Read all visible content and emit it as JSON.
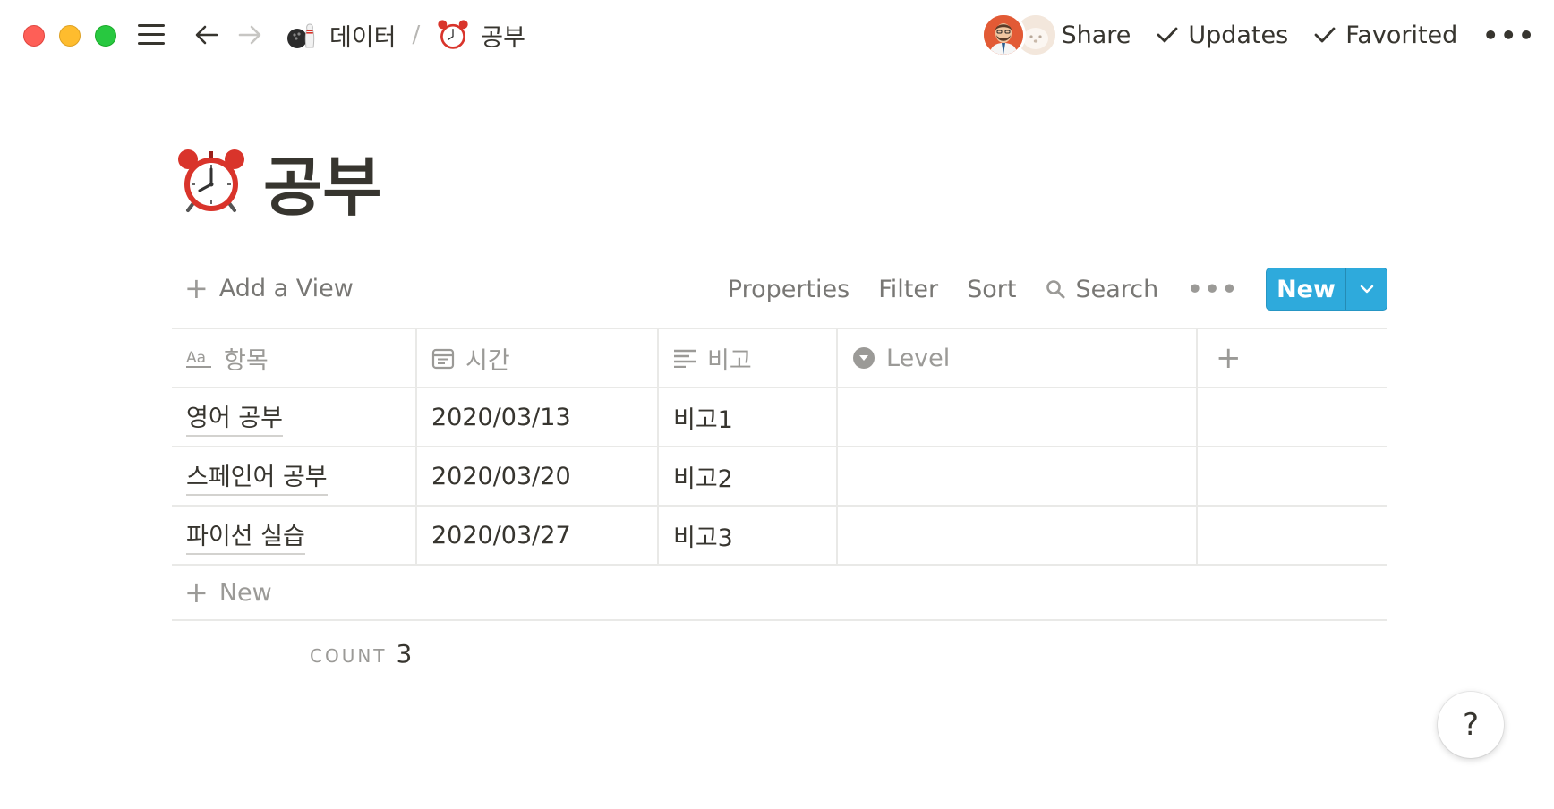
{
  "window": {
    "controls": [
      "close",
      "minimize",
      "zoom"
    ]
  },
  "breadcrumb": {
    "items": [
      {
        "emoji": "🎳",
        "label": "데이터"
      },
      {
        "emoji": "⏰",
        "label": "공부"
      }
    ],
    "separator": "/"
  },
  "topbar": {
    "share_label": "Share",
    "updates_label": "Updates",
    "favorited_label": "Favorited",
    "more_label": "•••"
  },
  "page": {
    "title": "공부",
    "icon": "alarm-clock-icon"
  },
  "view_toolbar": {
    "add_view_label": "Add a View",
    "properties_label": "Properties",
    "filter_label": "Filter",
    "sort_label": "Sort",
    "search_label": "Search",
    "more_label": "•••",
    "new_label": "New"
  },
  "table": {
    "columns": [
      {
        "label": "항목",
        "icon": "text-title-icon"
      },
      {
        "label": "시간",
        "icon": "calendar-icon"
      },
      {
        "label": "비고",
        "icon": "text-lines-icon"
      },
      {
        "label": "Level",
        "icon": "select-icon"
      }
    ],
    "add_column_label": "+",
    "rows": [
      {
        "title": "영어 공부",
        "date": "2020/03/13",
        "note": "비고1",
        "level": ""
      },
      {
        "title": "스페인어 공부",
        "date": "2020/03/20",
        "note": "비고2",
        "level": ""
      },
      {
        "title": "파이선 실습",
        "date": "2020/03/27",
        "note": "비고3",
        "level": ""
      }
    ],
    "new_row_label": "New"
  },
  "footer": {
    "count_label": "COUNT",
    "count_value": "3"
  },
  "help_label": "?",
  "colors": {
    "accent": "#2eaadc",
    "text": "#37352f",
    "muted": "#9b9a97",
    "border": "#e9e9e7"
  }
}
